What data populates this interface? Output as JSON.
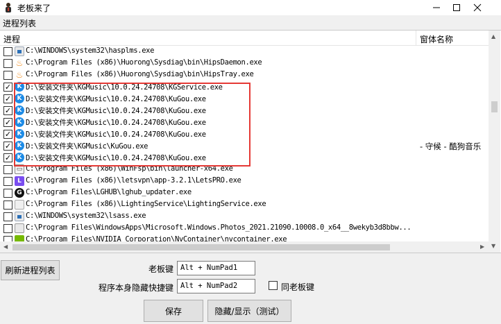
{
  "window": {
    "title": "老板来了",
    "controls": {
      "minimize": "—",
      "maximize": "☐",
      "close": "✕"
    }
  },
  "process_group": {
    "label": "进程列表",
    "columns": {
      "process": "进程",
      "window_title": "窗体名称"
    },
    "rows": [
      {
        "checked": false,
        "icon": "generic-exe-icon",
        "path": "C:\\WINDOWS\\system32\\hasplms.exe",
        "window_title": ""
      },
      {
        "checked": false,
        "icon": "huorong-icon",
        "path": "C:\\Program Files (x86)\\Huorong\\Sysdiag\\bin\\HipsDaemon.exe",
        "window_title": ""
      },
      {
        "checked": false,
        "icon": "huorong-icon",
        "path": "C:\\Program Files (x86)\\Huorong\\Sysdiag\\bin\\HipsTray.exe",
        "window_title": ""
      },
      {
        "checked": true,
        "icon": "kugou-icon",
        "path": "D:\\安装文件夹\\KGMusic\\10.0.24.24708\\KGService.exe",
        "window_title": ""
      },
      {
        "checked": true,
        "icon": "kugou-icon",
        "path": "D:\\安装文件夹\\KGMusic\\10.0.24.24708\\KuGou.exe",
        "window_title": ""
      },
      {
        "checked": true,
        "icon": "kugou-icon",
        "path": "D:\\安装文件夹\\KGMusic\\10.0.24.24708\\KuGou.exe",
        "window_title": ""
      },
      {
        "checked": true,
        "icon": "kugou-icon",
        "path": "D:\\安装文件夹\\KGMusic\\10.0.24.24708\\KuGou.exe",
        "window_title": ""
      },
      {
        "checked": true,
        "icon": "kugou-icon",
        "path": "D:\\安装文件夹\\KGMusic\\10.0.24.24708\\KuGou.exe",
        "window_title": ""
      },
      {
        "checked": true,
        "icon": "kugou-icon",
        "path": "D:\\安装文件夹\\KGMusic\\KuGou.exe",
        "window_title": "- 守候 - 酷狗音乐"
      },
      {
        "checked": true,
        "icon": "kugou-icon",
        "path": "D:\\安装文件夹\\KGMusic\\10.0.24.24708\\KuGou.exe",
        "window_title": ""
      },
      {
        "checked": false,
        "icon": "winfsp-icon",
        "path": "C:\\Program Files (x86)\\WinFsp\\bin\\launcher-x64.exe",
        "window_title": ""
      },
      {
        "checked": false,
        "icon": "letsvpn-icon",
        "path": "C:\\Program Files (x86)\\letsvpn\\app-3.2.1\\LetsPRO.exe",
        "window_title": ""
      },
      {
        "checked": false,
        "icon": "lghub-icon",
        "path": "C:\\Program Files\\LGHUB\\lghub_updater.exe",
        "window_title": ""
      },
      {
        "checked": false,
        "icon": "lighting-service-icon",
        "path": "C:\\Program Files (x86)\\LightingService\\LightingService.exe",
        "window_title": ""
      },
      {
        "checked": false,
        "icon": "generic-exe-icon",
        "path": "C:\\WINDOWS\\system32\\lsass.exe",
        "window_title": ""
      },
      {
        "checked": false,
        "icon": "photos-icon",
        "path": "C:\\Program Files\\WindowsApps\\Microsoft.Windows.Photos_2021.21090.10008.0_x64__8wekyb3d8bbw...",
        "window_title": ""
      },
      {
        "checked": false,
        "icon": "nvidia-icon",
        "path": "C:\\Program Files\\NVIDIA Corporation\\NvContainer\\nvcontainer.exe",
        "window_title": ""
      }
    ]
  },
  "controls": {
    "refresh_button": "刷新进程列表",
    "boss_key_label": "老板键",
    "boss_key_value": "Alt + NumPad1",
    "self_hide_label": "程序本身隐藏快捷键",
    "self_hide_value": "Alt + NumPad2",
    "same_as_boss_label": "同老板键",
    "same_as_boss_checked": false,
    "save_button": "保存",
    "toggle_button": "隐藏/显示（测试）"
  },
  "colors": {
    "highlight_border": "#e53935",
    "window_bg": "#f0f0f0",
    "kugou_blue": "#1d8be6"
  }
}
